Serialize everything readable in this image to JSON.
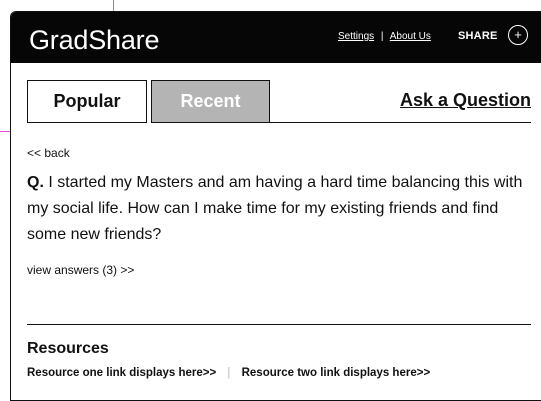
{
  "header": {
    "brand": "GradShare",
    "links": [
      "Settings",
      "About Us"
    ],
    "separator": "|",
    "share_label": "SHARE",
    "share_icon": "plus-circle-icon",
    "share_symbol": "+"
  },
  "tabs": {
    "items": [
      {
        "label": "Popular",
        "active": true
      },
      {
        "label": "Recent",
        "active": false
      }
    ],
    "ask_label": "Ask a Question"
  },
  "question": {
    "back_label": "<< back",
    "label": "Q.",
    "text": "I started my Masters and am having a hard time balancing this with my social life. How can I make time for my existing friends and find some new friends?",
    "view_answers": "view answers (3) >>"
  },
  "resources": {
    "title": "Resources",
    "links": [
      "Resource one link displays here>>",
      "Resource two link displays here>>"
    ],
    "separator": "|"
  },
  "colors": {
    "header_bg": "#060606",
    "header_text": "#ffffff",
    "active_tab_bg": "#ffffff",
    "inactive_tab_bg": "#b4b4b4",
    "guide_line": "#e84fd6"
  }
}
